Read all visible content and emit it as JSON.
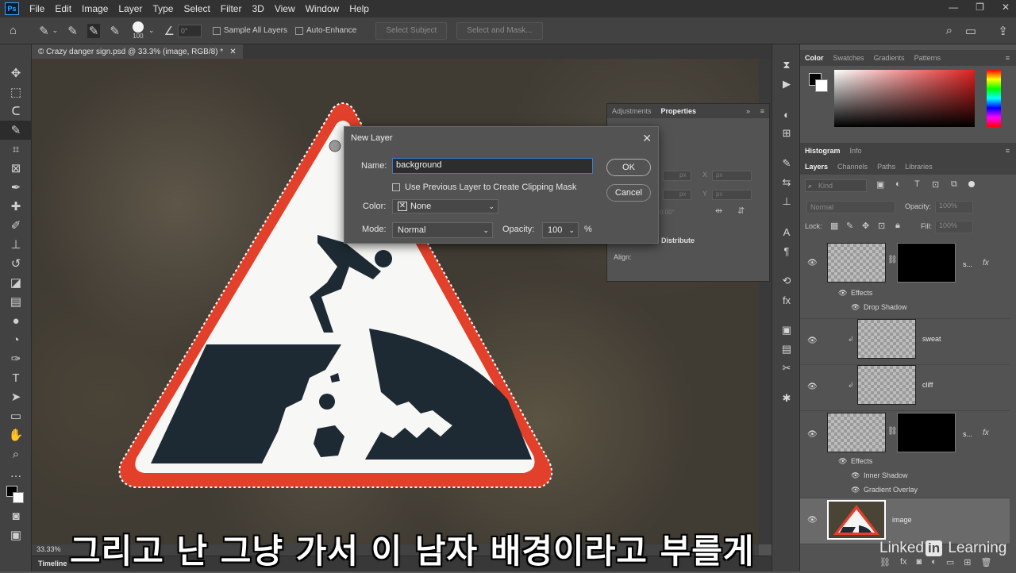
{
  "menu": [
    "File",
    "Edit",
    "Image",
    "Layer",
    "Type",
    "Select",
    "Filter",
    "3D",
    "View",
    "Window",
    "Help"
  ],
  "options_bar": {
    "brush_size": "100",
    "angle": "0°",
    "sample_all_layers": "Sample All Layers",
    "auto_enhance": "Auto-Enhance",
    "select_subject": "Select Subject",
    "select_and_mask": "Select and Mask..."
  },
  "document": {
    "tab_title": "© Crazy danger sign.psd @ 33.3% (image, RGB/8) *",
    "zoom": "33.33%"
  },
  "dialog": {
    "title": "New Layer",
    "name_label": "Name:",
    "name_value": "background",
    "clip_label": "Use Previous Layer to Create Clipping Mask",
    "color_label": "Color:",
    "color_value": "None",
    "mode_label": "Mode:",
    "mode_value": "Normal",
    "opacity_label": "Opacity:",
    "opacity_value": "100",
    "percent": "%",
    "ok": "OK",
    "cancel": "Cancel"
  },
  "properties_panel": {
    "tabs": [
      "Adjustments",
      "Properties"
    ],
    "fields": [
      "px",
      "px",
      "px",
      "px"
    ],
    "axis_x": "X",
    "axis_y": "Y",
    "angle": "0.00°",
    "distribute": "Distribute",
    "align": "Align:"
  },
  "color_panel": {
    "tabs": [
      "Color",
      "Swatches",
      "Gradients",
      "Patterns"
    ],
    "accent": "#e02020"
  },
  "histogram_tabs": [
    "Histogram",
    "Info"
  ],
  "layers_panel": {
    "tabs": [
      "Layers",
      "Channels",
      "Paths",
      "Libraries"
    ],
    "kind": "Kind",
    "blend": "Normal",
    "opacity_label": "Opacity:",
    "opacity": "100%",
    "lock_label": "Lock:",
    "fill_label": "Fill:",
    "fill": "100%",
    "layers": [
      {
        "name": "s...",
        "effects_label": "Effects",
        "effects": [
          "Drop Shadow"
        ]
      },
      {
        "name": "sweat"
      },
      {
        "name": "cliff"
      },
      {
        "name": "s...",
        "effects_label": "Effects",
        "effects": [
          "Inner Shadow",
          "Gradient Overlay"
        ]
      },
      {
        "name": "image"
      }
    ],
    "fx": "fx"
  },
  "subtitle": "그리고 난 그냥 가서 이 남자 배경이라고 부를게",
  "watermark": {
    "pre": "Linked",
    "in": "in",
    "post": " Learning"
  },
  "timeline": "Timeline"
}
